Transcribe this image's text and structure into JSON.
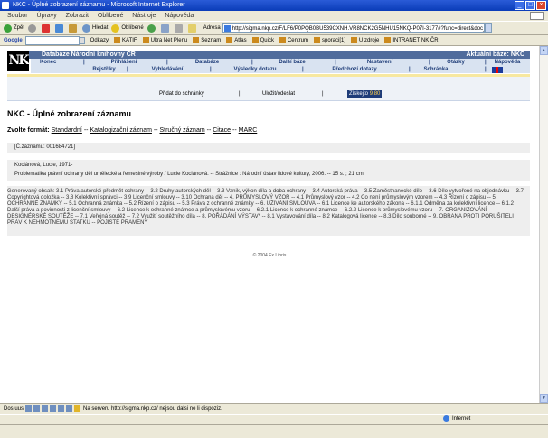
{
  "window": {
    "title": "NKC - Úplné zobrazení záznamu - Microsoft Internet Explorer"
  },
  "menubar": [
    "Soubor",
    "Úpravy",
    "Zobrazit",
    "Oblíbené",
    "Nástroje",
    "Nápověda"
  ],
  "toolbar": {
    "back": "Zpět",
    "search": "Hledat",
    "favorites": "Oblíbené",
    "address_label": "Adresa",
    "address": "http://sigma.nkp.cz/F/LF6/P0PQB0BU539CXNH.VR8NCK2G5NHU15NKQ-P07I-3177#?func=direct&doc_number"
  },
  "googlebar": {
    "logo": "Google",
    "bookmarks": [
      "Odkazy",
      "KATIF",
      "Ultra Net Plenu",
      "Seznam",
      "Atlas",
      "Quick",
      "Centrum",
      "sporaci[1]",
      "U zdroje",
      "INTRANET NK ČR"
    ]
  },
  "site": {
    "logo": "NK",
    "db_title": "Databáze Národní knihovny ČR",
    "active_base": "Aktuální báze:  NKC",
    "nav_row1": [
      "Konec",
      "Přihlášení",
      "Databáze",
      "Další báze",
      "Nastavení",
      "Otázky",
      "Nápověda"
    ],
    "nav_row2": [
      "Rejstříky",
      "Vyhledávání",
      "Výsledky dotazu",
      "Předchozí dotazy",
      "Schránka"
    ],
    "flag": "english-flag-icon"
  },
  "actions": {
    "add": "Přidat do schránky",
    "save": "Uložit/odeslat",
    "get": "Získejto",
    "get_badge": "9.80"
  },
  "page": {
    "title": "NKC - Úplné zobrazení záznamu",
    "format_label": "Zvolte formát:",
    "formats": [
      "Standardní",
      "Katalogizační záznam",
      "Stručný záznam",
      "Citace",
      "MARC"
    ],
    "record_no": "[Č.záznamu: 001684721]",
    "author": "Kociánová, Lucie, 1971-",
    "title_stmt": "Problematika právní ochrany děl umělecké a řemeslné výroby / Lucie Kociánová. -- Strážnice : Národní ústav lidové kultury, 2006. -- 15 s. ; 21 cm",
    "contents": "Generovaný obsah: 3.1 Práva autorské předmět ochrany -- 3.2 Druhy autorských děl -- 3.3 Vznik, výkon díla a doba ochrany -- 3.4 Autorská práva -- 3.5 Zaměstnanecké dílo -- 3.6 Dílo vytvořené na objednávku -- 3.7 Copyrightová doložka -- 3.8 Kolektivní správci -- 3.9 Licenční smlouvy -- 3.10 Ochrana děl -- 4. PRŮMYSLOVÝ VZOR -- 4.1 Průmyslový vzor -- 4.2 Co není průmyslovým vzorem -- 4.3 Řízení o zápisu -- 5. OCHRANNÉ ZNÁMKY -- 5.1 Ochranná známka -- 5.2 Řízení o zápisu -- 5.3 Práva z ochranné známky -- 6. UŽIVÁNÍ SMLOUVA -- 6.1 Licence ke autorského zákona -- 6.1.1 Odměna za kolektivní licence -- 6.1.2 Další práva a povinnosti z licenční smlouvy -- 6.2 Licence k ochranné známce a průmyslovému vzoru -- 6.2.1 Licence k ochranné známce -- 6.2.2 Licence k průmyslovému vzoru -- 7. ORGANIZOVÁNÍ DESIGNÉRSKÉ SOUTĚŽE -- 7.1 Veřejná soutěž -- 7.2 Využití soutěžního díla -- 8. POŘÁDÁNÍ VÝSTAV* -- 8.1 Vystavování díla -- 8.2 Katalogová licence -- 8.3 Dílo souborné -- 9. OBRANA PROTI PORUŠITELI PRÁV K NEHMOTNÉMU STATKU -- POJISTĚ PRAMENY",
    "footer": "© 2004 Ex Libris"
  },
  "statusbar": {
    "message": "Na serveru http://sigma.nkp.cz/ nejsou dalsi ne li dispoziz.",
    "zone": "Internet"
  },
  "taskbar_label": "Dos uus"
}
